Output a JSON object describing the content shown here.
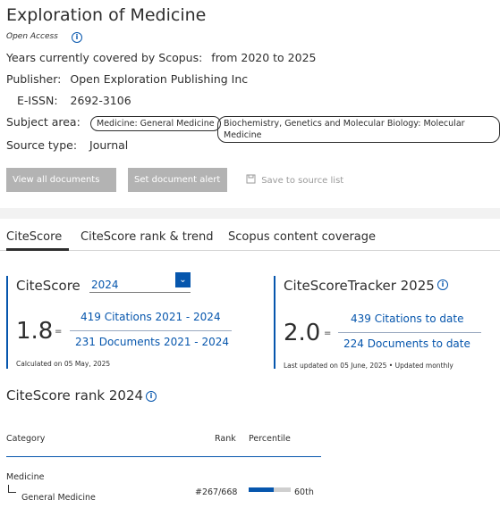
{
  "header": {
    "title": "Exploration of Medicine",
    "open_access": "Open Access",
    "years_label": "Years currently covered by Scopus:",
    "years_value": "from 2020 to 2025",
    "publisher_label": "Publisher:",
    "publisher_value": "Open Exploration Publishing Inc",
    "eissn_label": "E-ISSN:",
    "eissn_value": "2692-3106",
    "subject_label": "Subject area:",
    "subject_pills": [
      "Medicine: General Medicine",
      "Biochemistry, Genetics and Molecular Biology: Molecular Medicine"
    ],
    "source_type_label": "Source type:",
    "source_type_value": "Journal"
  },
  "actions": {
    "view_all": "View all documents",
    "view_all_chevron": ">",
    "set_alert": "Set document alert",
    "save_to_list": "Save to source list"
  },
  "tabs": [
    "CiteScore",
    "CiteScore rank & trend",
    "Scopus content coverage"
  ],
  "citescore": {
    "heading": "CiteScore",
    "year_selected": "2024",
    "value": "1.8",
    "equals": "=",
    "numerator": "419 Citations 2021 - 2024",
    "denominator": "231 Documents 2021 - 2024",
    "note": "Calculated on 05 May, 2025"
  },
  "tracker": {
    "heading": "CiteScoreTracker 2025",
    "value": "2.0",
    "equals": "=",
    "numerator": "439 Citations to date",
    "denominator": "224 Documents to date",
    "note": "Last updated on 05 June, 2025 • Updated monthly"
  },
  "rank": {
    "heading": "CiteScore rank 2024",
    "col_category": "Category",
    "col_rank": "Rank",
    "col_percentile": "Percentile",
    "category": "Medicine",
    "subcategory": "General Medicine",
    "rank_value": "#267/668",
    "percentile_value": "60th",
    "percentile_fraction": 0.6
  },
  "colors": {
    "accent": "#0656ad",
    "button_disabled": "#b3b3b3"
  }
}
